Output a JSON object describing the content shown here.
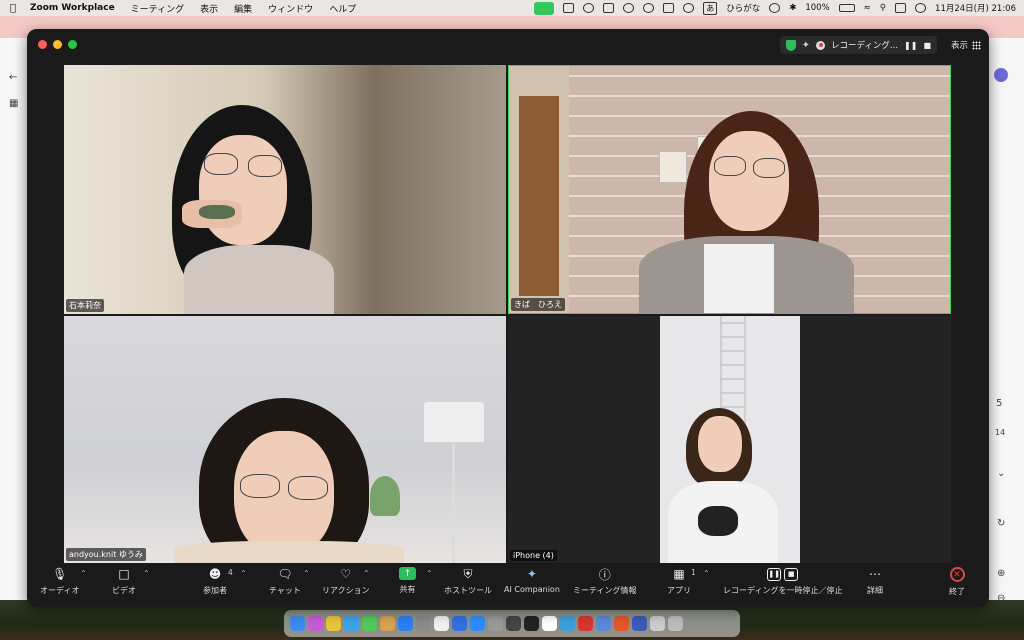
{
  "menubar": {
    "app_name": "Zoom Workplace",
    "menus": [
      "ミーティング",
      "表示",
      "編集",
      "ウィンドウ",
      "ヘルプ"
    ],
    "input_badge": "あ",
    "input_mode": "ひらがな",
    "battery": "100%",
    "datetime": "11月24日(月)  21:06"
  },
  "browser_bg": {
    "right_number_1": "5",
    "right_number_2": "14"
  },
  "window": {
    "recording_label": "レコーディング...",
    "view_label": "表示"
  },
  "participants": [
    {
      "name": "石本莉奈"
    },
    {
      "name": "きば　ひろえ"
    },
    {
      "name": "andyou.knit ゆうみ"
    },
    {
      "name": "iPhone (4)"
    }
  ],
  "toolbar": {
    "audio": "オーディオ",
    "video": "ビデオ",
    "participants": "参加者",
    "participants_count": "4",
    "chat": "チャット",
    "reactions": "リアクション",
    "share": "共有",
    "host_tools": "ホストツール",
    "ai_companion": "AI Companion",
    "meeting_info": "ミーティング情報",
    "apps": "アプリ",
    "apps_count": "1",
    "recording_control": "レコーディングを一時停止／停止",
    "details": "詳細",
    "end": "終了"
  },
  "colors": {
    "share_green": "#2dbd5a",
    "end_red": "#e54343",
    "active_speaker_border": "#3fcf5a"
  }
}
